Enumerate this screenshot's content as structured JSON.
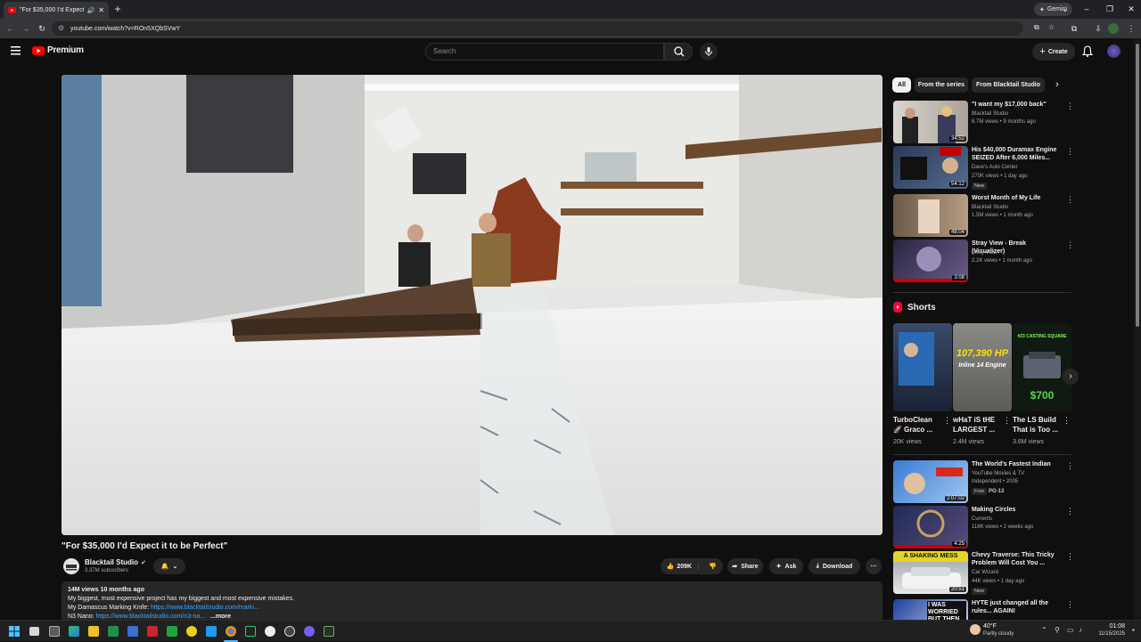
{
  "browser": {
    "tab_title": "\"For $35,000 I'd Expect it to…",
    "new_tab": "+",
    "gemini_label": "Gemini",
    "url": "youtube.com/watch?v=ROn5XQbSVwY",
    "win_min": "–",
    "win_max": "❐",
    "win_close": "✕"
  },
  "youtube": {
    "logo_text": "Premium",
    "search_placeholder": "Search",
    "create_label": "Create"
  },
  "video": {
    "title": "\"For $35,000 I'd Expect it to be Perfect\"",
    "channel": "Blacktail Studio",
    "subscribers": "3.37M subscribers",
    "likes": "209K",
    "share_label": "Share",
    "ask_label": "Ask",
    "download_label": "Download",
    "views_date": "14M views  10 months ago",
    "desc_line1": "My biggest, most expensive project has my biggest and most expensive mistakes.",
    "desc_line2_prefix": "My Damascus Marking Knife: ",
    "desc_line2_link": "https://www.blacktailstudio.com/marki...",
    "desc_line3_prefix": "N3 Nano: ",
    "desc_line3_link": "https://www.blacktailstudio.com/n3-na...",
    "more_label": "...more"
  },
  "chips": [
    "All",
    "From the series",
    "From Blacktail Studio"
  ],
  "recommendations_top": [
    {
      "title": "\"I want my $17,000 back\"",
      "channel": "Blacktail Studio",
      "meta": "8.7M views • 9 months ago",
      "duration": "34:52"
    },
    {
      "title": "His $40,000 Duramax Engine SEIZED After 6,000 Miles... No...",
      "channel": "Dave's Auto Center",
      "meta": "270K views • 1 day ago",
      "badge": "New",
      "duration": "54:12"
    },
    {
      "title": "Worst Month of My Life",
      "channel": "Blacktail Studio",
      "meta": "1.5M views • 1 month ago",
      "duration": "48:04"
    },
    {
      "title": "Stray View - Break (Visualizer)",
      "channel": "Stray View",
      "meta": "2.2K views • 1 month ago",
      "duration": "3:08"
    }
  ],
  "shorts": {
    "header": "Shorts",
    "items": [
      {
        "title": "TurboClean 🚀 Graco ...",
        "views": "20K views"
      },
      {
        "title": "wHaT iS tHE LARGEST ...",
        "views": "2.4M views",
        "overlay": "107,390 HP",
        "overlay2": "Inline 14 Engine"
      },
      {
        "title": "The LS Build That is Too ...",
        "views": "3.6M views",
        "overlay": "$700",
        "overlay_top": "#23 CASTING SQUARE"
      }
    ]
  },
  "recommendations_bottom": [
    {
      "title": "The World's Fastest Indian",
      "channel": "YouTube Movies & TV",
      "meta": "Independent • 2005",
      "badge": "Free",
      "rating": "PG-13",
      "duration": "2:07:02"
    },
    {
      "title": "Making Circles",
      "channel": "Currents",
      "meta": "118K views • 2 weeks ago",
      "duration": "4:25"
    },
    {
      "title": "Chevy Traverse: This Tricky Problem Will Cost You ...",
      "channel": "Car Wizard",
      "meta": "44K views • 1 day ago",
      "badge": "New",
      "duration": "20:51",
      "overlay": "A SHAKING MESS"
    },
    {
      "title": "HYTE just changed all the rules... AGAIN!",
      "channel": "",
      "meta": "",
      "overlay": "I WAS WORRIED BUT THEN"
    }
  ],
  "taskbar": {
    "weather_temp": "40°F",
    "weather_desc": "Partly cloudy",
    "time": "01:08",
    "date": "11/15/2025"
  },
  "colors": {
    "bg": "#0f0f0f",
    "accent_red": "#ff0000",
    "link_blue": "#3ea6ff"
  }
}
